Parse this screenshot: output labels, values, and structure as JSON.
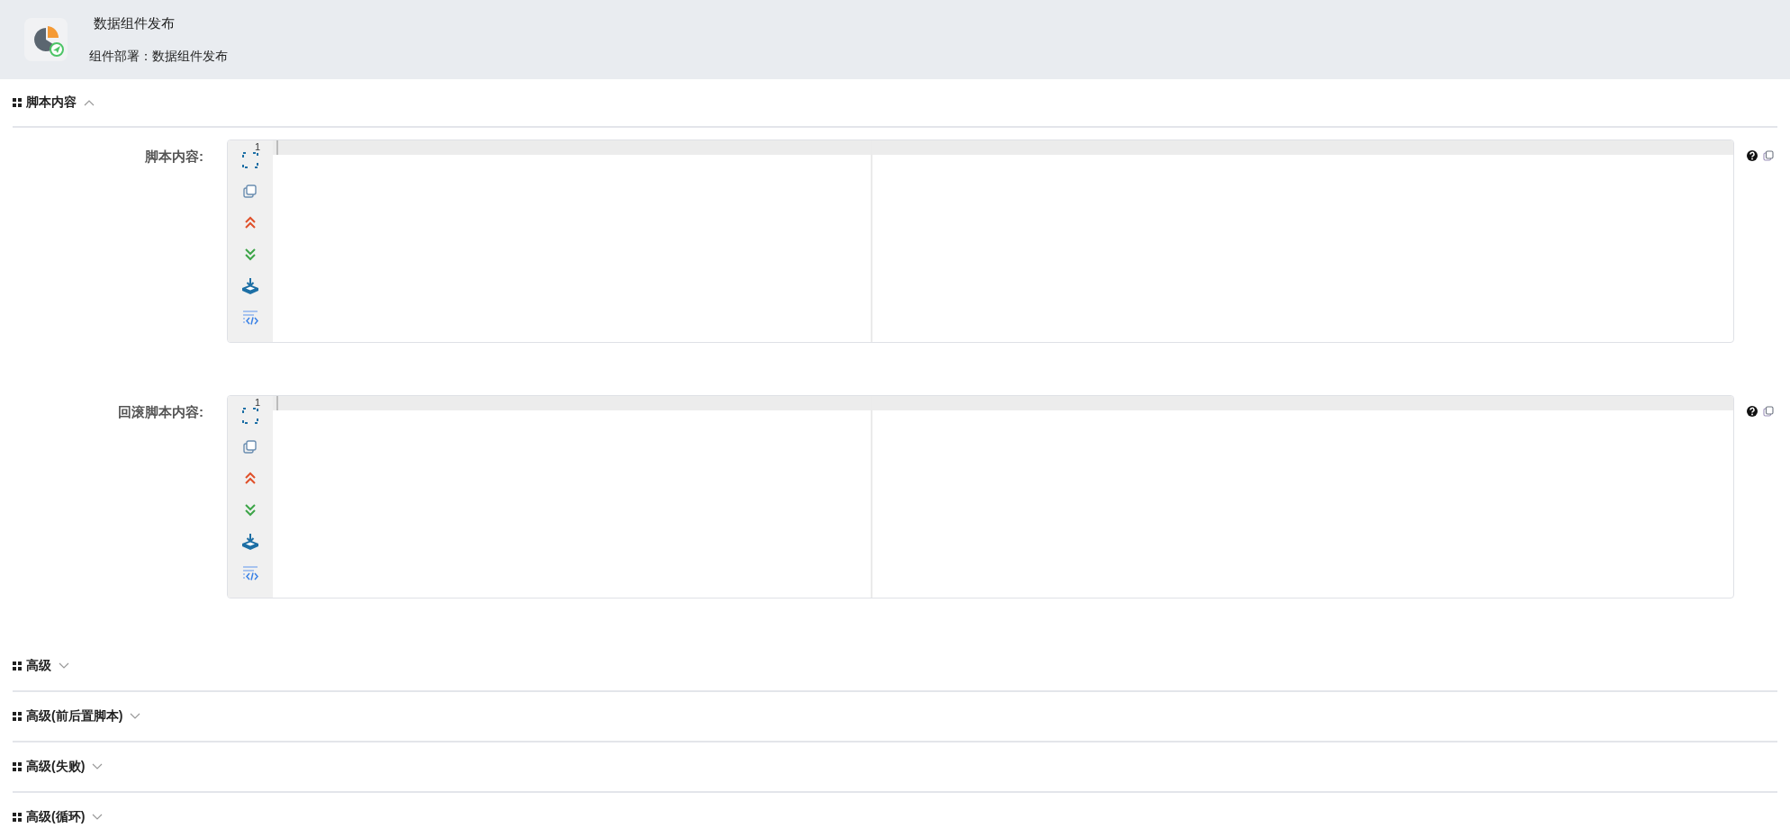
{
  "header": {
    "title": "数据组件发布",
    "subtitle": "组件部署：数据组件发布"
  },
  "sections": [
    {
      "title": "脚本内容",
      "expanded": true,
      "fields": [
        {
          "label": "脚本内容:",
          "line_number": "1"
        },
        {
          "label": "回滚脚本内容:",
          "line_number": "1"
        }
      ]
    },
    {
      "title": "高级",
      "expanded": false
    },
    {
      "title": "高级(前后置脚本)",
      "expanded": false
    },
    {
      "title": "高级(失败)",
      "expanded": false
    },
    {
      "title": "高级(循环)",
      "expanded": false
    }
  ]
}
